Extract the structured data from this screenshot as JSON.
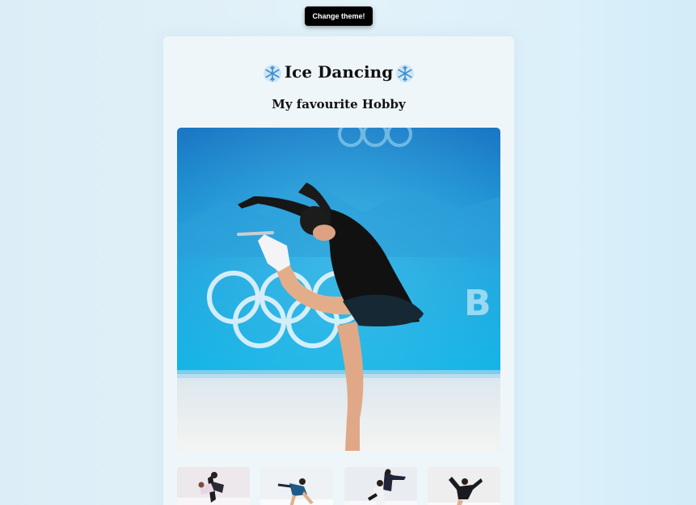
{
  "theme_button": {
    "label": "Change theme!"
  },
  "header": {
    "title": "Ice Dancing",
    "subtitle": "My favourite Hobby",
    "decoration_icon": "snowflake-icon"
  },
  "gallery": {
    "main_image": "figure-skater-layback-spin",
    "thumbnails": [
      "pair-skaters-thumbnail-1",
      "skater-blue-dress-thumbnail-2",
      "pair-lift-thumbnail-3",
      "skater-black-dress-thumbnail-4"
    ]
  },
  "colors": {
    "button_bg": "#000000",
    "card_bg": "#eef6fa",
    "page_bg": "#dcedf7",
    "rink_blue": "#1aa9de"
  }
}
